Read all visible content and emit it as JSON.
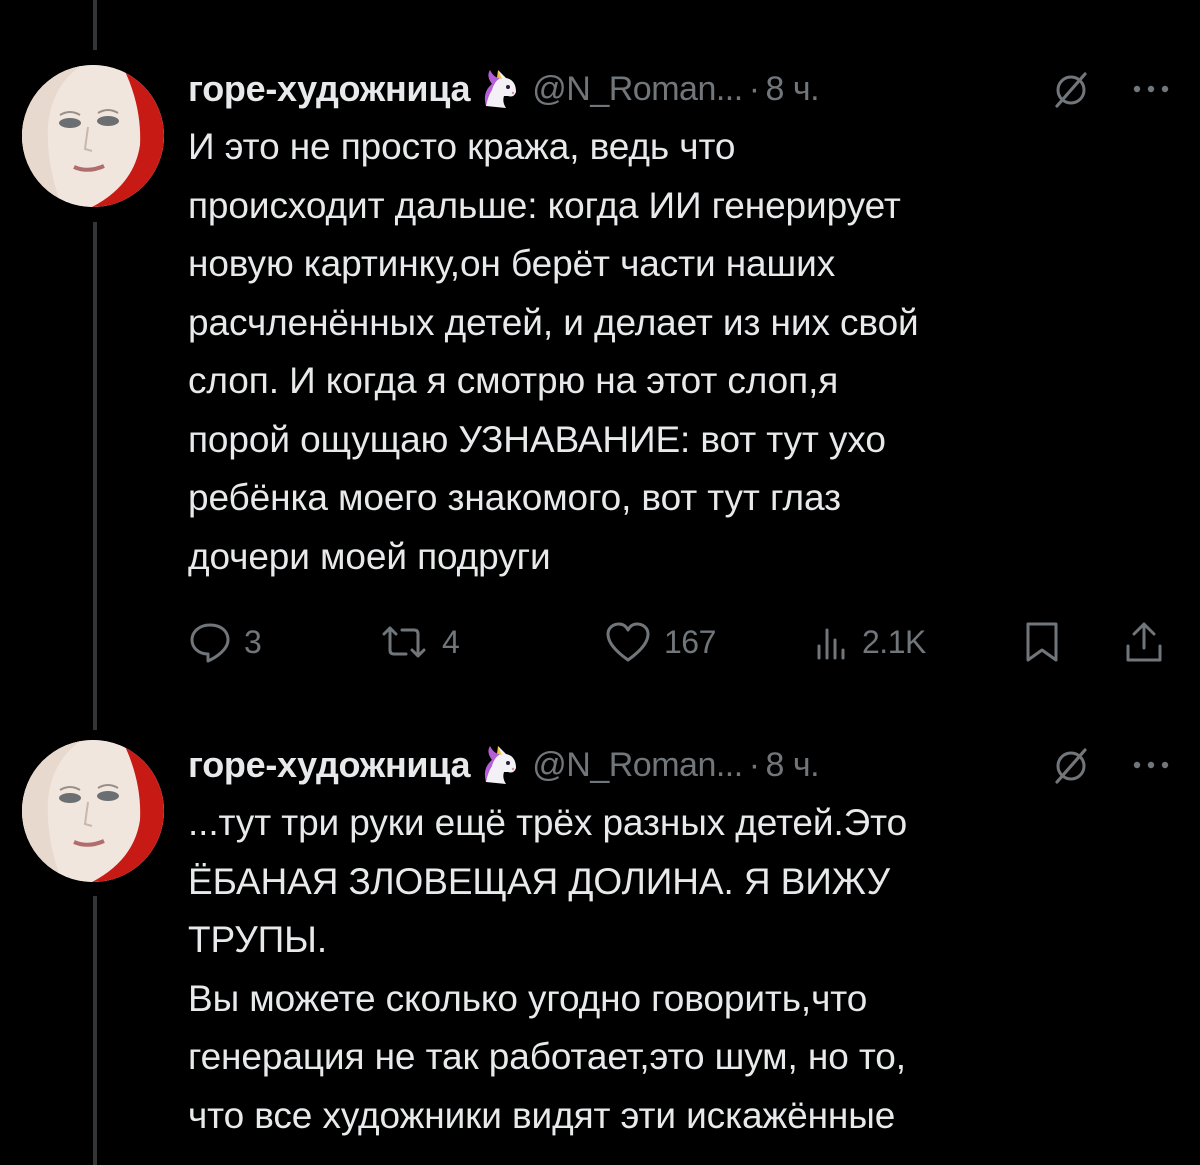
{
  "tweets": [
    {
      "author_name": "горе-художница",
      "author_emoji": "🦄",
      "handle": "@N_Roman...",
      "separator": "·",
      "time": "8 ч.",
      "text": "И это не просто кража, ведь что\nпроисходит дальше: когда ИИ генерирует\nновую картинку,он берёт части наших\nрасчленённых детей, и делает из них свой\nслоп. И когда я смотрю на этот слоп,я\nпорой ощущаю УЗНАВАНИЕ: вот тут ухо\nребёнка моего знакомого, вот тут глаз\nдочери моей подруги",
      "replies": "3",
      "retweets": "4",
      "likes": "167",
      "views": "2.1K"
    },
    {
      "author_name": "горе-художница",
      "author_emoji": "🦄",
      "handle": "@N_Roman...",
      "separator": "·",
      "time": "8 ч.",
      "text": "...тут три руки ещё трёх разных детей.Это\nЁБАНАЯ ЗЛОВЕЩАЯ ДОЛИНА. Я ВИЖУ\nТРУПЫ.\nВы можете сколько угодно говорить,что\nгенерация не так работает,это шум, но то,\nчто все художники видят эти искажённые"
    }
  ],
  "icons": {
    "grok": "grok-icon",
    "more": "more-icon",
    "reply": "reply-icon",
    "retweet": "retweet-icon",
    "like": "heart-icon",
    "views": "views-icon",
    "bookmark": "bookmark-icon",
    "share": "share-icon"
  },
  "colors": {
    "background": "#000000",
    "text": "#e7e9ea",
    "secondary": "#71767b",
    "thread_line": "#333639"
  }
}
